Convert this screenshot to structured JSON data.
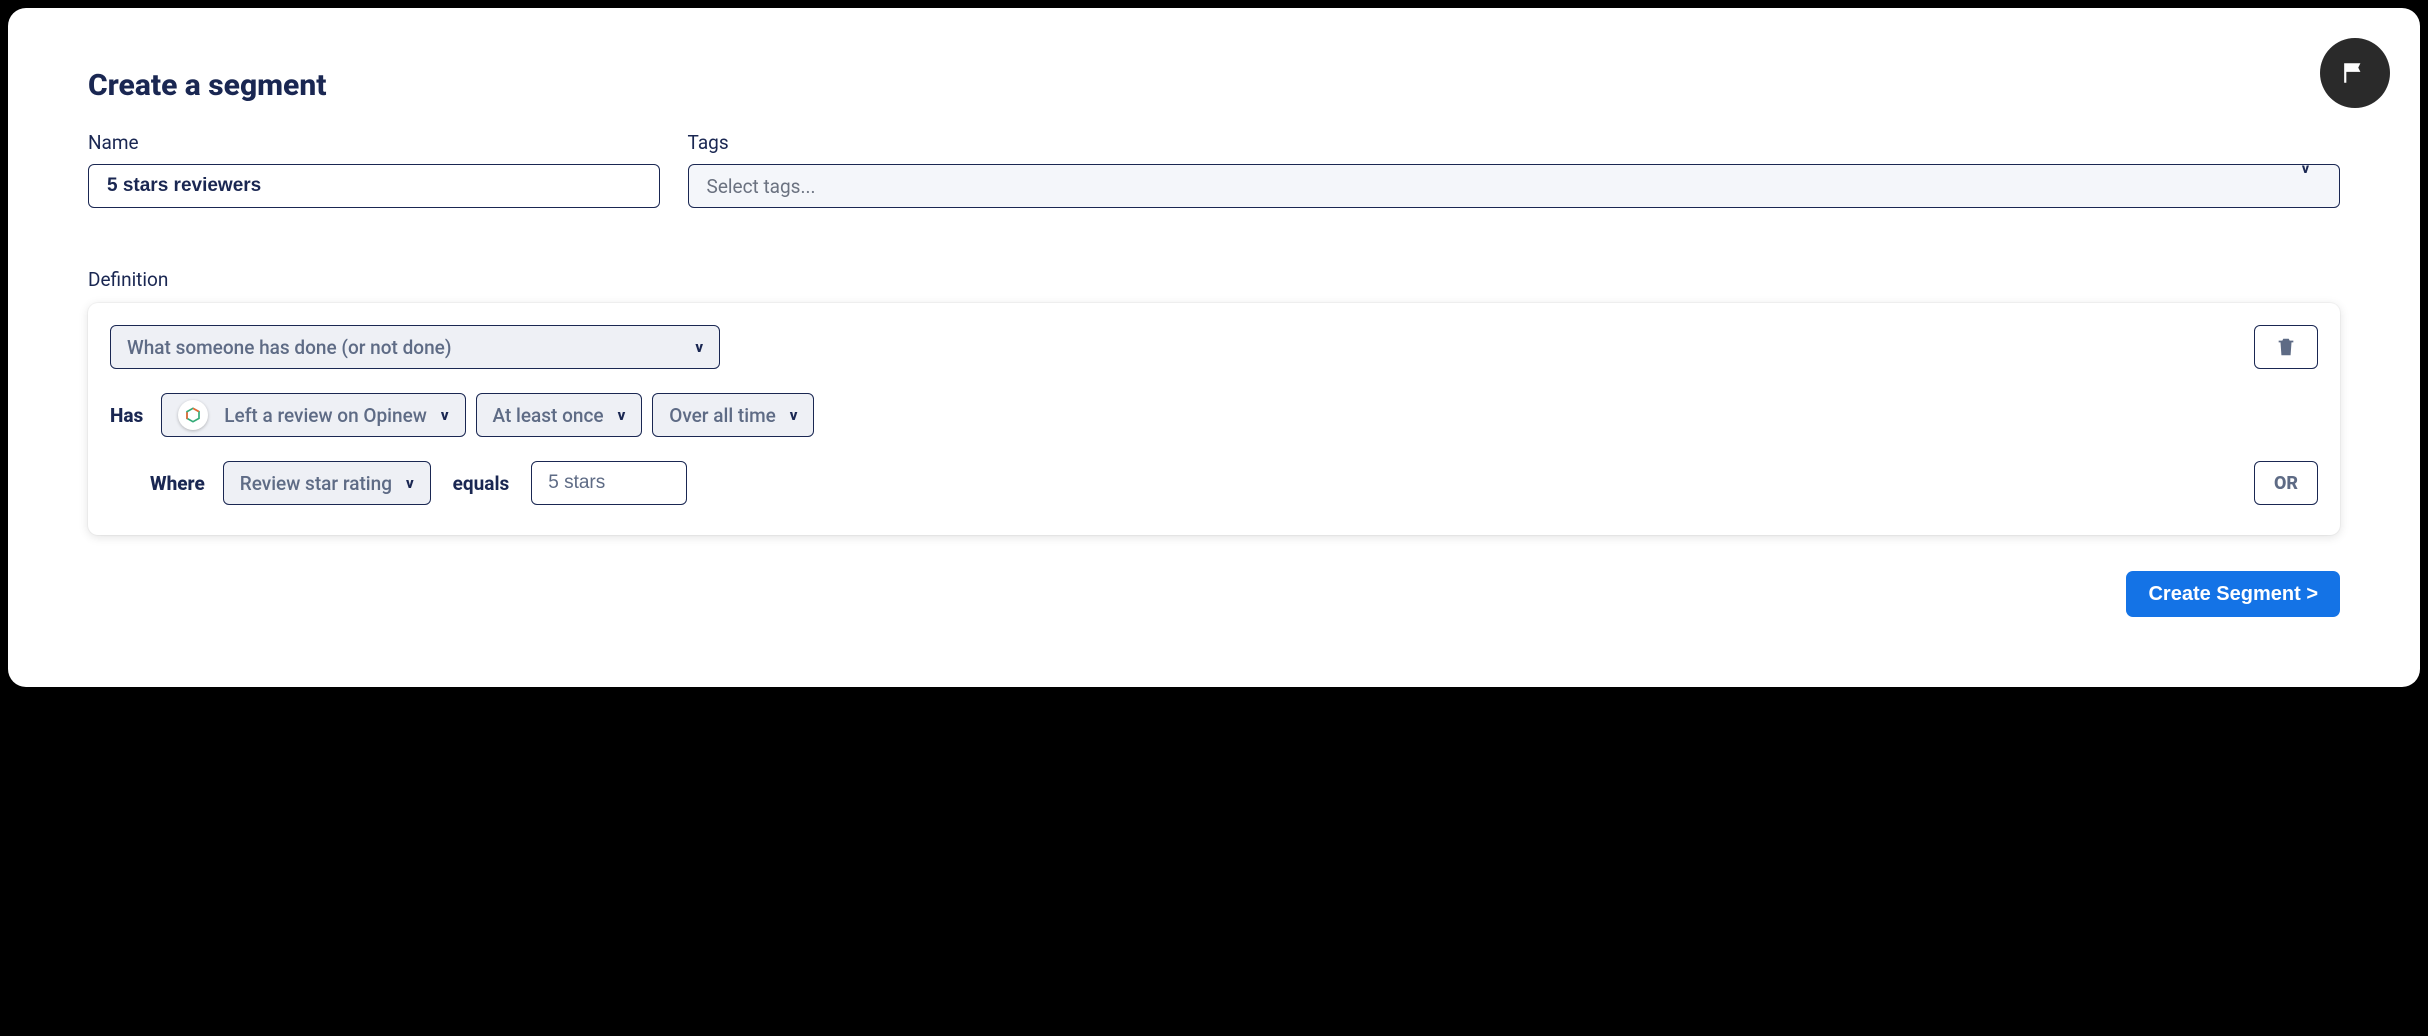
{
  "header": {
    "title": "Create a segment"
  },
  "fields": {
    "name_label": "Name",
    "name_value": "5 stars reviewers",
    "tags_label": "Tags",
    "tags_placeholder": "Select tags..."
  },
  "definition": {
    "label": "Definition",
    "condition_type": "What someone has done (or not done)",
    "has_label": "Has",
    "action_value": "Left a review on Opinew",
    "frequency_value": "At least once",
    "timeframe_value": "Over all time",
    "where_label": "Where",
    "property_value": "Review star rating",
    "operator_label": "equals",
    "comparison_value": "5 stars",
    "or_label": "OR"
  },
  "footer": {
    "submit_label": "Create Segment >"
  },
  "dropdown_caret": "v"
}
